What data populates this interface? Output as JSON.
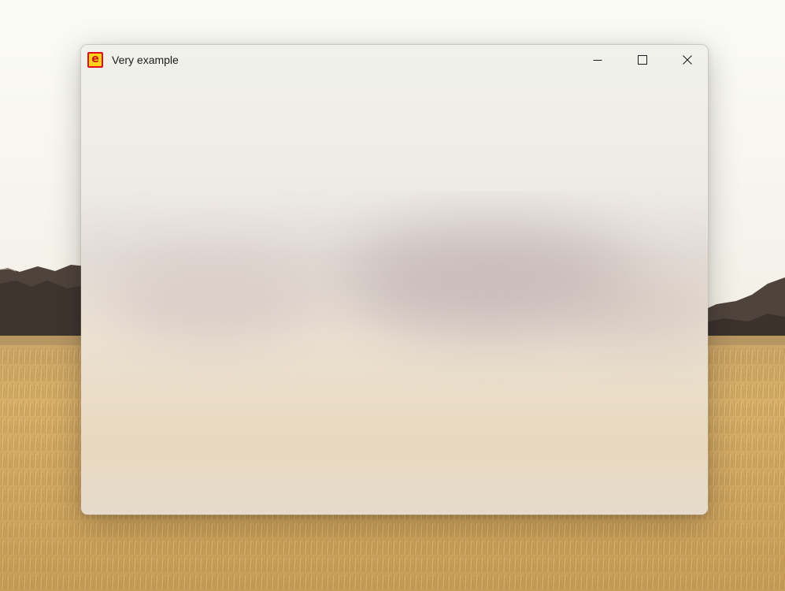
{
  "window": {
    "title": "Very example",
    "app_icon_glyph": "e",
    "app_icon_name": "app-e-icon"
  },
  "caption_buttons": {
    "minimize_icon": "minimize-icon",
    "maximize_icon": "maximize-icon",
    "close_icon": "close-icon"
  },
  "colors": {
    "icon_fill": "#ffd21a",
    "icon_border": "#e0101a",
    "title_text": "#1b1b1b",
    "grass": "#d2ab62",
    "mountain": "#4e433c",
    "sky": "#f6f4ee"
  }
}
